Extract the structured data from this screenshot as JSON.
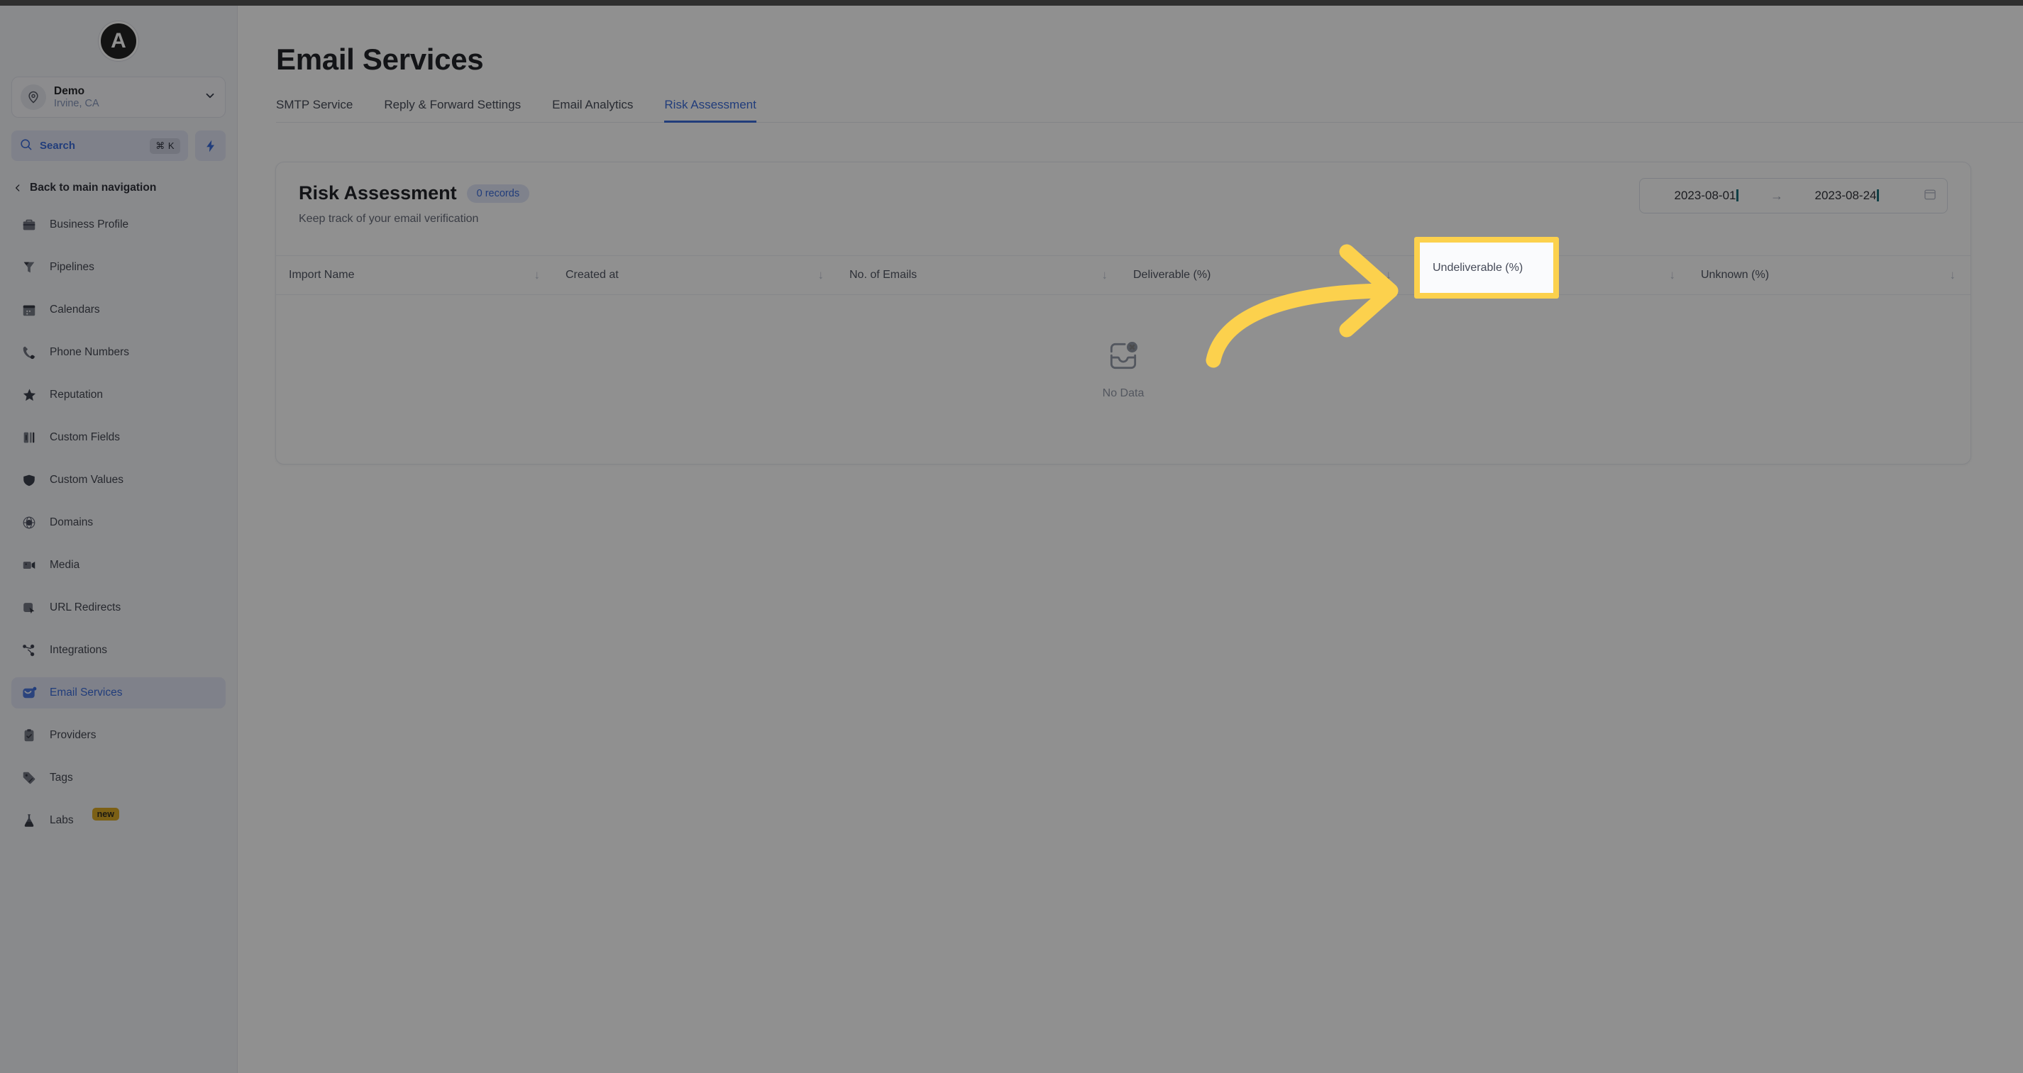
{
  "brand": {
    "logo_letter": "A",
    "accent": "#2f62d8",
    "highlight": "#fcd14d"
  },
  "sidebar": {
    "location": {
      "name": "Demo",
      "sub": "Irvine, CA"
    },
    "search": {
      "label": "Search",
      "shortcut": "⌘ K"
    },
    "back_label": "Back to main navigation",
    "items": [
      {
        "label": "Business Profile",
        "icon": "briefcase-icon",
        "active": false
      },
      {
        "label": "Pipelines",
        "icon": "funnel-icon",
        "active": false
      },
      {
        "label": "Calendars",
        "icon": "calendar-icon",
        "active": false
      },
      {
        "label": "Phone Numbers",
        "icon": "phone-icon",
        "active": false
      },
      {
        "label": "Reputation",
        "icon": "star-icon",
        "active": false
      },
      {
        "label": "Custom Fields",
        "icon": "columns-icon",
        "active": false
      },
      {
        "label": "Custom Values",
        "icon": "shield-icon",
        "active": false
      },
      {
        "label": "Domains",
        "icon": "globe-icon",
        "active": false
      },
      {
        "label": "Media",
        "icon": "video-icon",
        "active": false
      },
      {
        "label": "URL Redirects",
        "icon": "cursor-square-icon",
        "active": false
      },
      {
        "label": "Integrations",
        "icon": "nodes-icon",
        "active": false
      },
      {
        "label": "Email Services",
        "icon": "envelope-icon",
        "active": true
      },
      {
        "label": "Providers",
        "icon": "clipboard-check-icon",
        "active": false
      },
      {
        "label": "Tags",
        "icon": "tag-icon",
        "active": false
      },
      {
        "label": "Labs",
        "icon": "flask-icon",
        "active": false,
        "badge": "new"
      }
    ]
  },
  "main": {
    "page_title": "Email Services",
    "tabs": [
      {
        "label": "SMTP Service",
        "active": false
      },
      {
        "label": "Reply & Forward Settings",
        "active": false
      },
      {
        "label": "Email Analytics",
        "active": false
      },
      {
        "label": "Risk Assessment",
        "active": true
      }
    ],
    "card": {
      "title": "Risk Assessment",
      "records_pill": "0 records",
      "subtitle": "Keep track of your email verification",
      "date_range": {
        "start": "2023-08-01",
        "end": "2023-08-24",
        "separator": "→"
      },
      "columns": [
        {
          "label": "Import Name",
          "sortable": true
        },
        {
          "label": "Created at",
          "sortable": true
        },
        {
          "label": "No. of Emails",
          "sortable": true
        },
        {
          "label": "Deliverable (%)",
          "sortable": true
        },
        {
          "label": "Undeliverable (%)",
          "sortable": true
        },
        {
          "label": "Unknown (%)",
          "sortable": true
        }
      ],
      "rows": [],
      "empty_state": {
        "label": "No Data",
        "icon": "inbox-x-icon"
      }
    }
  },
  "annotation": {
    "highlighted_column": "Undeliverable (%)",
    "arrow": "curved-arrow-right"
  }
}
